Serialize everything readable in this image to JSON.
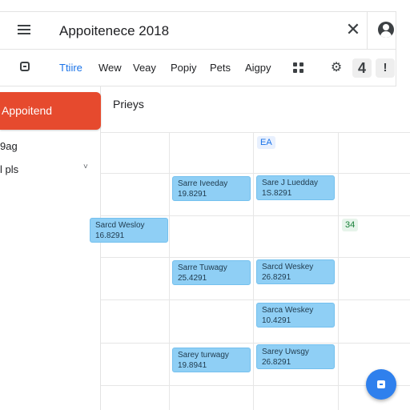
{
  "header": {
    "title": "Appoitenece 2018",
    "close_glyph": "✕"
  },
  "toolbar": {
    "tabs": [
      "Ttiire",
      "Wew",
      "Veay",
      "Popiy",
      "Pets",
      "Aigpy"
    ],
    "active_tab_index": 0,
    "badge_count": "4",
    "more_glyph": "!",
    "settings_glyph": "⚙"
  },
  "sidebar": {
    "primary_button_label": "Appoitend",
    "items": [
      "9ag",
      "l pls"
    ],
    "chevron_glyph": "˅"
  },
  "main": {
    "heading": "Prieys",
    "chips": [
      {
        "label": "EA",
        "color": "#1a73e8"
      },
      {
        "label": "34",
        "color": "#188038"
      }
    ],
    "events": [
      {
        "title": "Sarre Iveeday",
        "detail": "19.8291"
      },
      {
        "title": "Sare J Luedday",
        "detail": "1S.8291"
      },
      {
        "title": "Sarcd Wesloy",
        "detail": "16.8291"
      },
      {
        "title": "Sarre Tuwagy",
        "detail": "25.4291"
      },
      {
        "title": "Sarcd Weskey",
        "detail": "26.8291"
      },
      {
        "title": "Sarca Weskey",
        "detail": "10.4291"
      },
      {
        "title": "Sarey turwagy",
        "detail": "19.8941"
      },
      {
        "title": "Sarey Uwsgy",
        "detail": "26.8291"
      }
    ]
  },
  "fab": {
    "icon": "calendar-icon"
  },
  "colors": {
    "accent": "#1a73e8",
    "primary_button": "#e64a2e",
    "event_fill": "#8fcff5",
    "fab": "#2f80ed"
  }
}
